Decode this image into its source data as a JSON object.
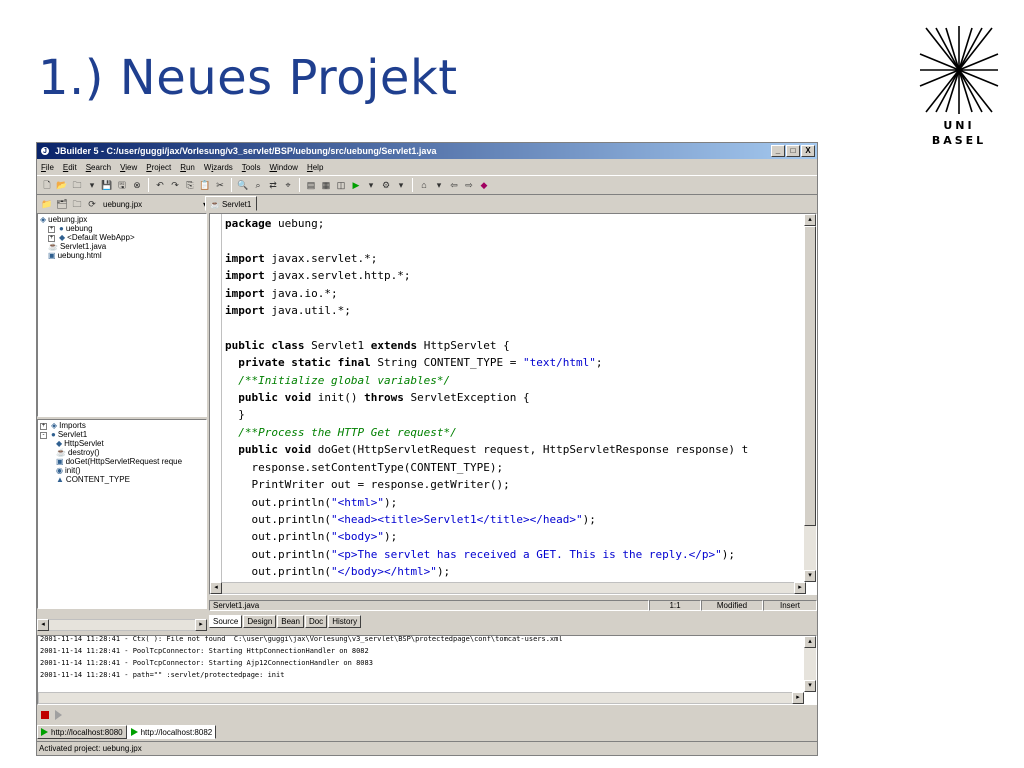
{
  "slide": {
    "title": "1.) Neues Projekt",
    "logo_line1": "UNI",
    "logo_line2": "BASEL"
  },
  "window": {
    "title": "JBuilder 5 - C:/user/guggi/jax/Vorlesung/v3_servlet/BSP/uebung/src/uebung/Servlet1.java",
    "buttons": [
      "_",
      "□",
      "X"
    ]
  },
  "menu": {
    "items": [
      {
        "u": "F",
        "rest": "ile"
      },
      {
        "u": "E",
        "rest": "dit"
      },
      {
        "u": "S",
        "rest": "earch"
      },
      {
        "u": "V",
        "rest": "iew"
      },
      {
        "u": "P",
        "rest": "roject"
      },
      {
        "u": "R",
        "rest": "un"
      },
      {
        "pre": "W",
        "u": "i",
        "rest": "zards"
      },
      {
        "u": "T",
        "rest": "ools"
      },
      {
        "u": "W",
        "rest": "indow"
      },
      {
        "u": "H",
        "rest": "elp"
      }
    ]
  },
  "project": {
    "selector": "uebung.jpx",
    "file_tab": "Servlet1"
  },
  "project_tree": [
    {
      "label": "uebung.jpx",
      "indent": 0,
      "expander": ""
    },
    {
      "label": "uebung",
      "indent": 1,
      "expander": "+"
    },
    {
      "label": "<Default WebApp>",
      "indent": 1,
      "expander": "+"
    },
    {
      "label": "Servlet1.java",
      "indent": 1,
      "expander": ""
    },
    {
      "label": "uebung.html",
      "indent": 1,
      "expander": ""
    }
  ],
  "structure_tree": [
    {
      "label": "Imports",
      "indent": 0,
      "expander": "+"
    },
    {
      "label": "Servlet1",
      "indent": 0,
      "expander": "-"
    },
    {
      "label": "HttpServlet",
      "indent": 2,
      "expander": ""
    },
    {
      "label": "destroy()",
      "indent": 2,
      "expander": ""
    },
    {
      "label": "doGet(HttpServletRequest reque",
      "indent": 2,
      "expander": ""
    },
    {
      "label": "init()",
      "indent": 2,
      "expander": ""
    },
    {
      "label": "CONTENT_TYPE",
      "indent": 2,
      "expander": ""
    }
  ],
  "code": {
    "line1": [
      "package",
      " uebung;"
    ],
    "imp1": [
      "import",
      " javax.servlet.*;"
    ],
    "imp2": [
      "import",
      " javax.servlet.http.*;"
    ],
    "imp3": [
      "import",
      " java.io.*;"
    ],
    "imp4": [
      "import",
      " java.util.*;"
    ],
    "cls": [
      "public class",
      " Servlet1 ",
      "extends",
      " HttpServlet {"
    ],
    "field": [
      "  ",
      "private static final",
      " String CONTENT_TYPE = ",
      "\"text/html\"",
      ";"
    ],
    "c1": "  /**Initialize global variables*/",
    "init": [
      "  ",
      "public void",
      " init() ",
      "throws",
      " ServletException {"
    ],
    "close1": "  }",
    "c2": "  /**Process the HTTP Get request*/",
    "doget": [
      "  ",
      "public void",
      " doGet(HttpServletRequest request, HttpServletResponse response) t"
    ],
    "s1": "    response.setContentType(CONTENT_TYPE);",
    "s2": "    PrintWriter out = response.getWriter();",
    "p1": [
      "    out.println(",
      "\"<html>\"",
      ");"
    ],
    "p2": [
      "    out.println(",
      "\"<head><title>Servlet1</title></head>\"",
      ");"
    ],
    "p3": [
      "    out.println(",
      "\"<body>\"",
      ");"
    ],
    "p4": [
      "    out.println(",
      "\"<p>The servlet has received a GET. This is the reply.</p>\"",
      ");"
    ],
    "p5": [
      "    out.println(",
      "\"</body></html>\"",
      ");"
    ],
    "close2": "  }"
  },
  "status": {
    "file": "Servlet1.java",
    "position": "1:1",
    "modified": "Modified",
    "mode": "Insert"
  },
  "view_tabs": [
    "Source",
    "Design",
    "Bean",
    "Doc",
    "History"
  ],
  "messages": [
    "2001-11-14 11:28:41 - Ctx( ): File not found  C:\\user\\guggi\\jax\\Vorlesung\\v3_servlet\\BSP\\protectedpage\\conf\\tomcat-users.xml",
    "2001-11-14 11:28:41 - PoolTcpConnector: Starting HttpConnectionHandler on 8082",
    "2001-11-14 11:28:41 - PoolTcpConnector: Starting Ajp12ConnectionHandler on 8083",
    "2001-11-14 11:28:41 - path=\"\" :servlet/protectedpage: init"
  ],
  "server_tabs": [
    "http://localhost:8080",
    "http://localhost:8082"
  ],
  "statusbar": "Activated project: uebung.jpx",
  "colors": {
    "title_blue": "#1f3f8f",
    "titlebar_start": "#0a246a",
    "titlebar_end": "#a6caf0",
    "chrome": "#d4d0c8",
    "string": "#0000d0",
    "comment": "#008000",
    "stop": "#c00000",
    "run": "#00a000"
  }
}
